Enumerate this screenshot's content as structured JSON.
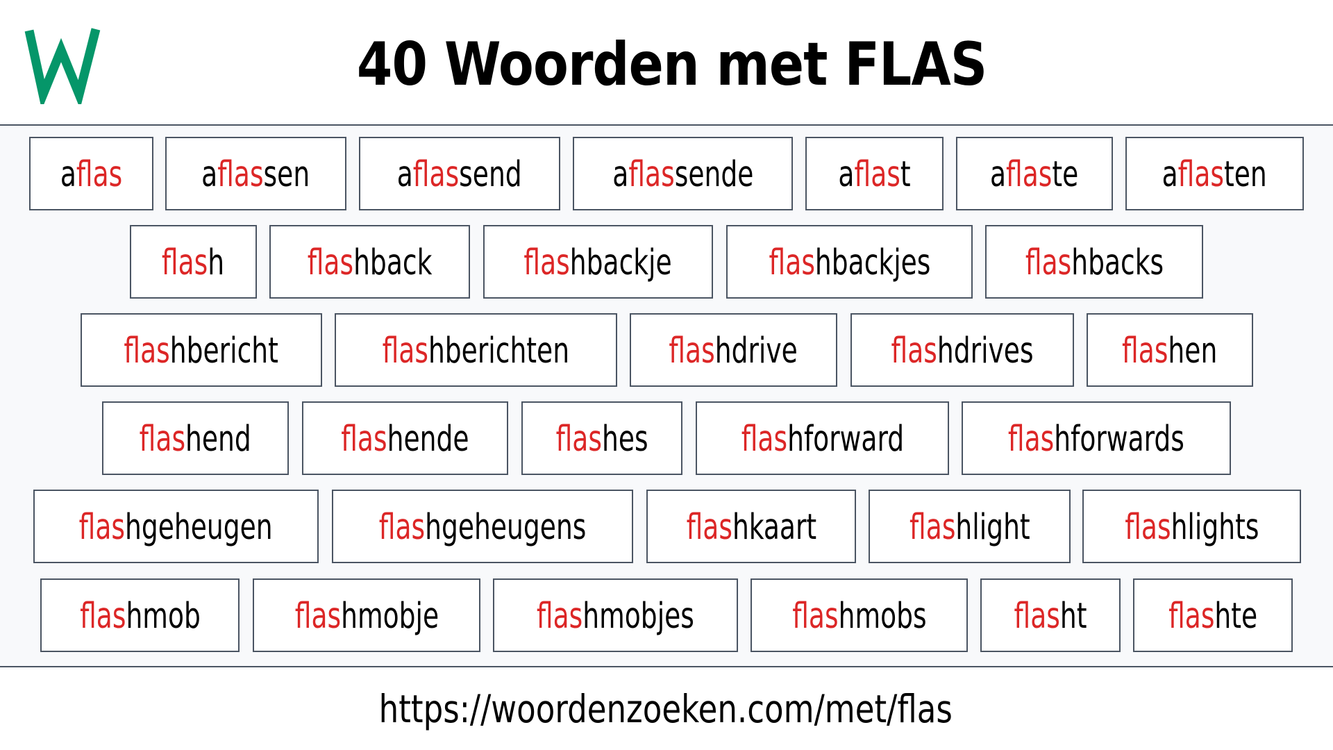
{
  "header": {
    "logo_letter": "W",
    "logo_color": "#059669",
    "title": "40 Woorden met FLAS"
  },
  "highlight": {
    "pattern": "flas",
    "color": "#dc2626"
  },
  "words": [
    [
      {
        "pre": "a",
        "hl": "flas",
        "post": ""
      },
      {
        "pre": "a",
        "hl": "flas",
        "post": "sen"
      },
      {
        "pre": "a",
        "hl": "flas",
        "post": "send"
      },
      {
        "pre": "a",
        "hl": "flas",
        "post": "sende"
      },
      {
        "pre": "a",
        "hl": "flas",
        "post": "t"
      },
      {
        "pre": "a",
        "hl": "flas",
        "post": "te"
      },
      {
        "pre": "a",
        "hl": "flas",
        "post": "ten"
      }
    ],
    [
      {
        "pre": "",
        "hl": "flas",
        "post": "h"
      },
      {
        "pre": "",
        "hl": "flas",
        "post": "hback"
      },
      {
        "pre": "",
        "hl": "flas",
        "post": "hbackje"
      },
      {
        "pre": "",
        "hl": "flas",
        "post": "hbackjes"
      },
      {
        "pre": "",
        "hl": "flas",
        "post": "hbacks"
      }
    ],
    [
      {
        "pre": "",
        "hl": "flas",
        "post": "hbericht"
      },
      {
        "pre": "",
        "hl": "flas",
        "post": "hberichten"
      },
      {
        "pre": "",
        "hl": "flas",
        "post": "hdrive"
      },
      {
        "pre": "",
        "hl": "flas",
        "post": "hdrives"
      },
      {
        "pre": "",
        "hl": "flas",
        "post": "hen"
      }
    ],
    [
      {
        "pre": "",
        "hl": "flas",
        "post": "hend"
      },
      {
        "pre": "",
        "hl": "flas",
        "post": "hende"
      },
      {
        "pre": "",
        "hl": "flas",
        "post": "hes"
      },
      {
        "pre": "",
        "hl": "flas",
        "post": "hforward"
      },
      {
        "pre": "",
        "hl": "flas",
        "post": "hforwards"
      }
    ],
    [
      {
        "pre": "",
        "hl": "flas",
        "post": "hgeheugen"
      },
      {
        "pre": "",
        "hl": "flas",
        "post": "hgeheugens"
      },
      {
        "pre": "",
        "hl": "flas",
        "post": "hkaart"
      },
      {
        "pre": "",
        "hl": "flas",
        "post": "hlight"
      },
      {
        "pre": "",
        "hl": "flas",
        "post": "hlights"
      }
    ],
    [
      {
        "pre": "",
        "hl": "flas",
        "post": "hmob"
      },
      {
        "pre": "",
        "hl": "flas",
        "post": "hmobje"
      },
      {
        "pre": "",
        "hl": "flas",
        "post": "hmobjes"
      },
      {
        "pre": "",
        "hl": "flas",
        "post": "hmobs"
      },
      {
        "pre": "",
        "hl": "flas",
        "post": "ht"
      },
      {
        "pre": "",
        "hl": "flas",
        "post": "hte"
      }
    ]
  ],
  "footer": {
    "url": "https://woordenzoeken.com/met/flas"
  }
}
